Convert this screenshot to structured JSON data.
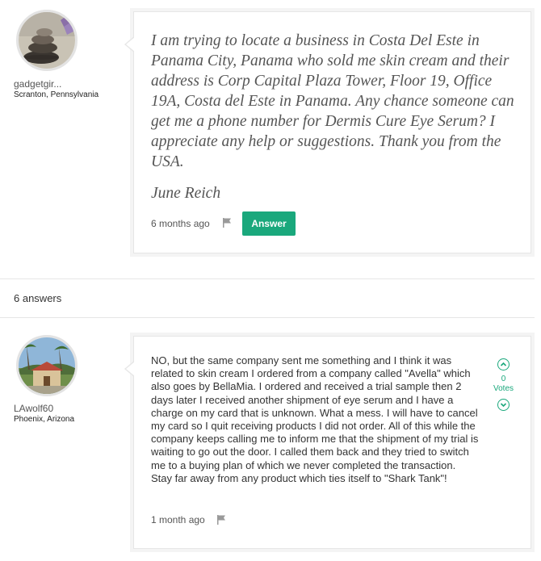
{
  "question": {
    "user": "gadgetgir...",
    "location": "Scranton, Pennsylvania",
    "text": "I am trying to locate a business in Costa Del Este in Panama City, Panama who sold me skin cream and their address is Corp Capital Plaza Tower, Floor 19, Office 19A, Costa del Este in Panama. Any chance someone can get me a phone number for Dermis Cure Eye Serum? I appreciate any help or suggestions. Thank you from the USA.",
    "signature": "June Reich",
    "time": "6 months ago",
    "answer_label": "Answer"
  },
  "answers_count": "6 answers",
  "answer": {
    "user": "LAwolf60",
    "location": "Phoenix, Arizona",
    "text": "NO, but the same company sent me something and I think it was related to skin cream I ordered from a company called \"Avella\" which also goes by BellaMia. I ordered and received a trial sample then 2 days later I received another shipment of eye serum and I have a charge on my card that is unknown. What a mess. I will have to cancel my card so I quit receiving products I did not order. All of this while the company keeps calling me to inform me that the shipment of my trial is waiting to go out the door. I called them back and they tried to switch me to a buying plan of which we never completed the transaction. Stay far away from any product which ties itself to \"Shark Tank\"!",
    "time": "1 month ago",
    "votes": "0",
    "votes_label": "Votes"
  },
  "colors": {
    "accent": "#1aa87c",
    "border": "#e6e6e6"
  },
  "icons": {
    "flag": "flag-icon",
    "upvote": "chevron-up-icon",
    "downvote": "chevron-down-icon"
  }
}
